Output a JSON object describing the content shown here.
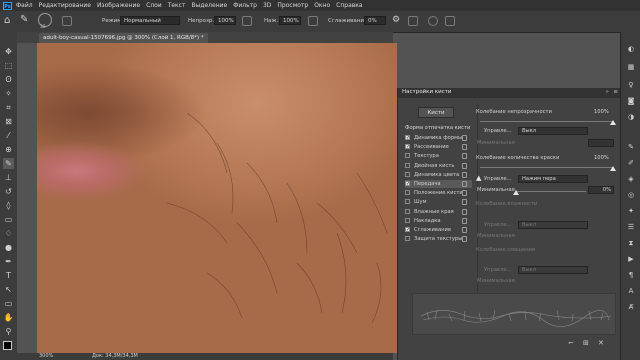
{
  "menu": [
    "Файл",
    "Редактирование",
    "Изображение",
    "Слои",
    "Текст",
    "Выделение",
    "Фильтр",
    "3D",
    "Просмотр",
    "Окно",
    "Справка"
  ],
  "app_logo": "Ps",
  "options": {
    "brush_size": "32",
    "mode_label": "Режим:",
    "mode_value": "Нормальный",
    "opacity_label": "Непрозр.:",
    "opacity_value": "100%",
    "flow_label": "Наж.:",
    "flow_value": "100%",
    "smoothing_label": "Сглаживание:",
    "smoothing_value": "0%"
  },
  "document": {
    "tab_title": "adult-boy-casual-1507696.jpg @ 300% (Слой 1, RGB/8*) *",
    "zoom": "300%",
    "doc_info": "Док: 34,3M/34,3M"
  },
  "brush_panel": {
    "title": "Настройки кисти",
    "brushes_button": "Кисти",
    "tip_shape_header": "Форма отпечатка кисти",
    "options": [
      {
        "label": "Динамика формы",
        "checked": true
      },
      {
        "label": "Рассеивание",
        "checked": true
      },
      {
        "label": "Текстура",
        "checked": false
      },
      {
        "label": "Двойная кисть",
        "checked": false
      },
      {
        "label": "Динамика цвета",
        "checked": false
      },
      {
        "label": "Передача",
        "checked": true
      },
      {
        "label": "Положение кисти",
        "checked": false
      },
      {
        "label": "Шум",
        "checked": false
      },
      {
        "label": "Влажные края",
        "checked": false
      },
      {
        "label": "Накладка",
        "checked": false
      },
      {
        "label": "Сглаживание",
        "checked": true
      },
      {
        "label": "Защита текстуры",
        "checked": false
      }
    ],
    "selected_option": 5,
    "right": {
      "opacity_jitter_label": "Колебание непрозрачности",
      "opacity_jitter_value": "100%",
      "control_label": "Управле...",
      "control_off": "Выкл",
      "minimum_label": "Минимальная",
      "paint_jitter_label": "Колебание количества краски",
      "paint_jitter_value": "100%",
      "control_pen": "Нажим пера",
      "minimum2_label": "Минимальная",
      "minimum2_value": "0%",
      "wet_jitter_label": "Колебание влажности",
      "control3_label": "Управле...",
      "control3_value": "Выкл",
      "min3_label": "Минимальная",
      "mix_jitter_label": "Колебание смешения",
      "control4_label": "Управле...",
      "control4_value": "Выкл",
      "min4_label": "Минимальная"
    },
    "sliders": {
      "opacity_jitter": 1.0,
      "paint_jitter": 1.0,
      "minimum2": 0.0
    }
  }
}
